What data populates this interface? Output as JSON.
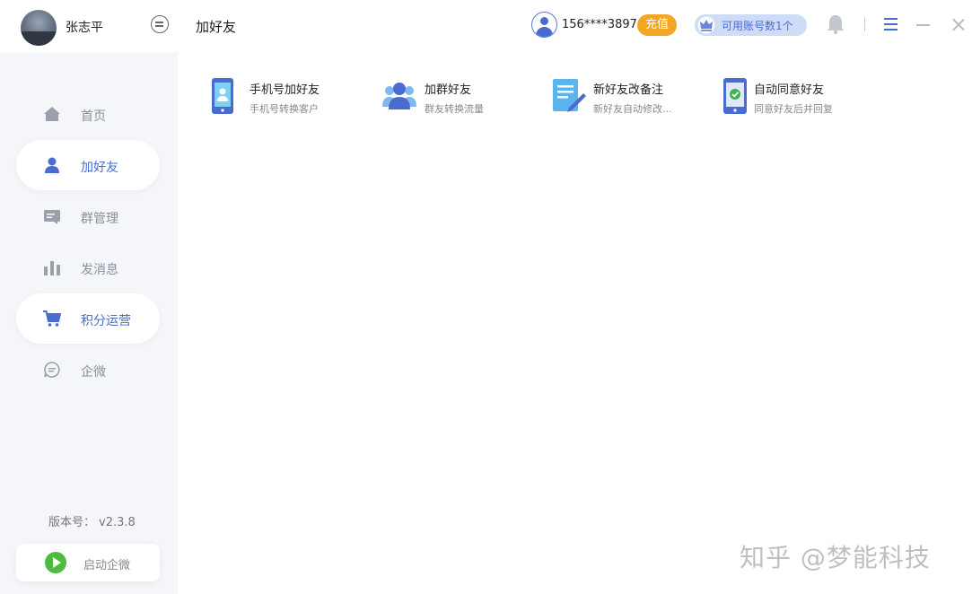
{
  "sidebar": {
    "username": "张志平",
    "items": [
      {
        "label": "首页"
      },
      {
        "label": "加好友"
      },
      {
        "label": "群管理"
      },
      {
        "label": "发消息"
      },
      {
        "label": "积分运营"
      },
      {
        "label": "企微"
      }
    ],
    "version_label": "版本号：",
    "version_value": "v2.3.8",
    "start_label": "启动企微"
  },
  "header": {
    "title": "加好友",
    "phone": "156****3897",
    "recharge_label": "充值",
    "accounts_label": "可用账号数1个"
  },
  "features": [
    {
      "title": "手机号加好友",
      "desc": "手机号转换客户"
    },
    {
      "title": "加群好友",
      "desc": "群友转换流量"
    },
    {
      "title": "新好友改备注",
      "desc": "新好友自动修改..."
    },
    {
      "title": "自动同意好友",
      "desc": "同意好友后并回复"
    }
  ],
  "watermark": "知乎 @梦能科技",
  "colors": {
    "accent": "#4a6bd0",
    "recharge": "#f5a524",
    "sidebar_bg": "#f4f6fa",
    "start_green": "#4cbb3e"
  }
}
